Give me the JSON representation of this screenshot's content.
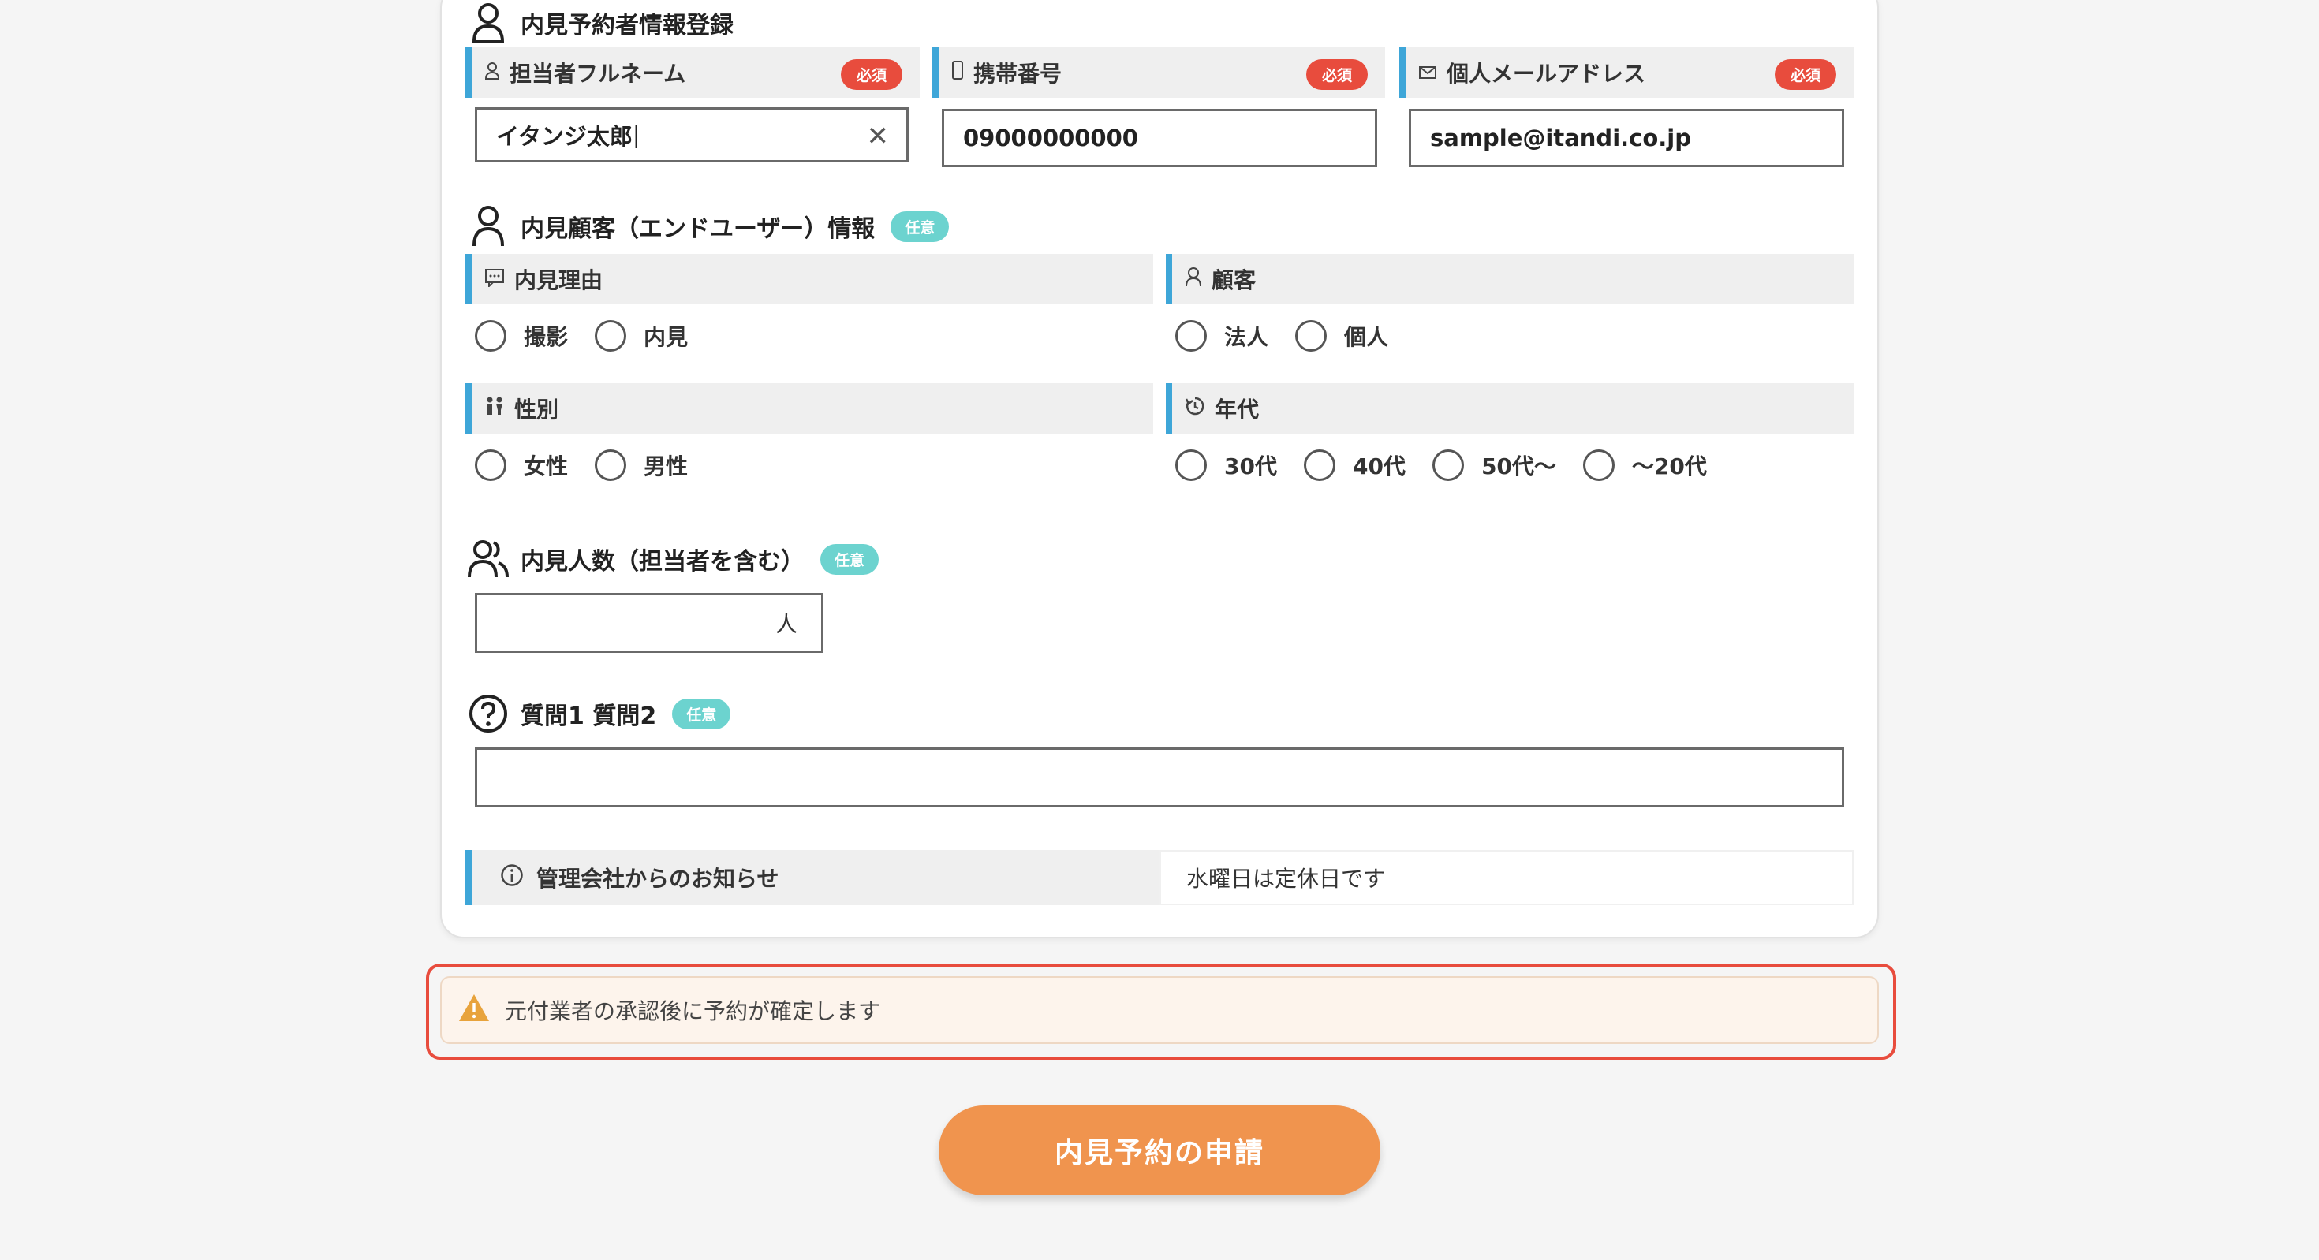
{
  "booker": {
    "title": "内見予約者情報登録",
    "name_label": "担当者フルネーム",
    "name_value": "イタンジ太郎",
    "phone_label": "携帯番号",
    "phone_value": "09000000000",
    "email_label": "個人メールアドレス",
    "email_value": "sample@itandi.co.jp",
    "required_badge": "必須",
    "clear_symbol": "✕"
  },
  "customer": {
    "title": "内見顧客（エンドユーザー）情報",
    "optional_badge": "任意",
    "reason_label": "内見理由",
    "reason_options": [
      "撮影",
      "内見"
    ],
    "customer_label": "顧客",
    "customer_options": [
      "法人",
      "個人"
    ],
    "gender_label": "性別",
    "gender_options": [
      "女性",
      "男性"
    ],
    "age_label": "年代",
    "age_options": [
      "30代",
      "40代",
      "50代〜",
      "〜20代"
    ]
  },
  "visitors": {
    "title": "内見人数（担当者を含む）",
    "optional_badge": "任意",
    "suffix": "人"
  },
  "questions": {
    "title": "質問1 質問2",
    "optional_badge": "任意"
  },
  "notice": {
    "label": "管理会社からのお知らせ",
    "text": "水曜日は定休日です"
  },
  "alert": {
    "text": "元付業者の承認後に予約が確定します"
  },
  "submit": {
    "label": "内見予約の申請"
  },
  "colors": {
    "accent_bar": "#3ea6d8",
    "required": "#e84c3d",
    "optional": "#6cd3cf",
    "submit": "#f0944e",
    "alert_outline": "#e84c3d"
  },
  "icons": [
    "person-icon",
    "phone-icon",
    "mail-icon",
    "chat-icon",
    "gender-icon",
    "age-icon",
    "group-icon",
    "question-icon",
    "info-icon",
    "warning-icon"
  ]
}
